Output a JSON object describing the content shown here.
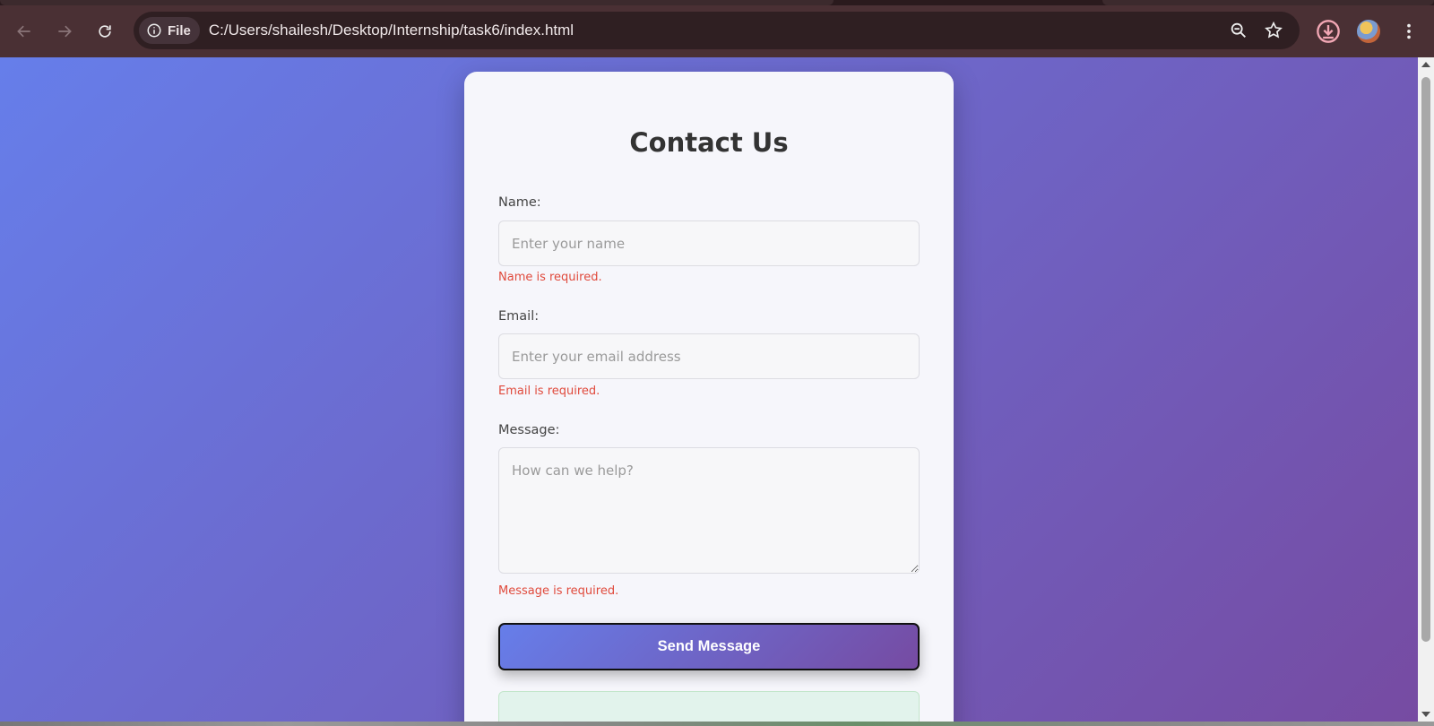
{
  "browser": {
    "site_chip_label": "File",
    "url": "C:/Users/shailesh/Desktop/Internship/task6/index.html",
    "icons": [
      "back-arrow-icon",
      "forward-arrow-icon",
      "reload-icon",
      "info-icon",
      "zoom-icon",
      "star-icon",
      "download-icon",
      "profile-avatar",
      "kebab-menu-icon"
    ]
  },
  "form": {
    "title": "Contact Us",
    "name": {
      "label": "Name:",
      "placeholder": "Enter your name",
      "error": "Name is required."
    },
    "email": {
      "label": "Email:",
      "placeholder": "Enter your email address",
      "error": "Email is required."
    },
    "message": {
      "label": "Message:",
      "placeholder": "How can we help?",
      "error": "Message is required."
    },
    "submit_label": "Send Message"
  },
  "colors": {
    "gradient_start": "#667eea",
    "gradient_end": "#764ba2",
    "error": "#e04a3c",
    "card": "#f6f6fb"
  }
}
